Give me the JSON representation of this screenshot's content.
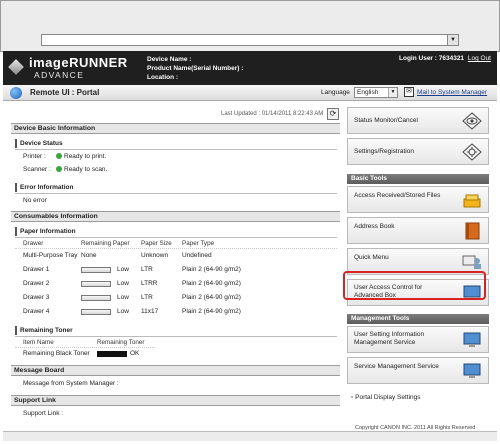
{
  "header": {
    "brand": "imageRUNNER",
    "brand_sub": "ADVANCE",
    "device_name_label": "Device Name :",
    "product_name_label": "Product Name(Serial Number) :",
    "location_label": "Location :",
    "login_user": "Login User : 7634321",
    "logout": "Log Out"
  },
  "portalbar": {
    "title": "Remote UI : Portal",
    "language_label": "Language",
    "language_value": "English",
    "mail_link": "Mail to System Manager"
  },
  "main": {
    "last_updated": "Last Updated : 01/14/2011 8:22:43 AM",
    "device_basic_info": "Device Basic Information",
    "device_status": "Device Status",
    "printer_label": "Printer :",
    "printer_status": "Ready to print.",
    "scanner_label": "Scanner :",
    "scanner_status": "Ready to scan.",
    "error_info": "Error Information",
    "no_error": "No error",
    "consumables_info": "Consumables Information",
    "paper_info": "Paper Information",
    "paper_headers": [
      "Drawer",
      "Remaining Paper",
      "Paper Size",
      "Paper Type"
    ],
    "paper_rows": [
      {
        "drawer": "Multi-Purpose Tray",
        "remaining": "None",
        "size": "Unknown",
        "type": "Undefined",
        "level": null
      },
      {
        "drawer": "Drawer 1",
        "remaining": "Low",
        "size": "LTR",
        "type": "Plain 2 (64-90 g/m2)",
        "level": 0.15
      },
      {
        "drawer": "Drawer 2",
        "remaining": "Low",
        "size": "LTRR",
        "type": "Plain 2 (64-90 g/m2)",
        "level": 0.15
      },
      {
        "drawer": "Drawer 3",
        "remaining": "Low",
        "size": "LTR",
        "type": "Plain 2 (64-90 g/m2)",
        "level": 0.15
      },
      {
        "drawer": "Drawer 4",
        "remaining": "Low",
        "size": "11x17",
        "type": "Plain 2 (64-90 g/m2)",
        "level": 0.15
      }
    ],
    "remaining_toner": "Remaining Toner",
    "toner_headers": [
      "Item Name",
      "Remaining Toner"
    ],
    "toner_row": {
      "name": "Remaining Black Toner",
      "status": "OK",
      "level": 1.0
    },
    "message_board": "Message Board",
    "message_text": "Message from System Manager :",
    "support_link_section": "Support Link",
    "support_link_text": "Support Link :"
  },
  "right": {
    "status_monitor": "Status Monitor/Cancel",
    "settings_registration": "Settings/Registration",
    "basic_tools": "Basic Tools",
    "access_received": "Access Received/Stored Files",
    "address_book": "Address Book",
    "quick_menu": "Quick Menu",
    "user_access_control": "User Access Control for Advanced Box",
    "management_tools": "Management Tools",
    "user_setting_info": "User Setting Information Management Service",
    "service_management": "Service Management Service",
    "portal_display_settings": "Portal Display Settings",
    "copyright": "Copyright CANON INC. 2011 All Rights Reserved"
  },
  "colors": {
    "header_bg": "#1f1f1f",
    "highlight": "#d82323",
    "status_ok": "#3ca53c"
  }
}
